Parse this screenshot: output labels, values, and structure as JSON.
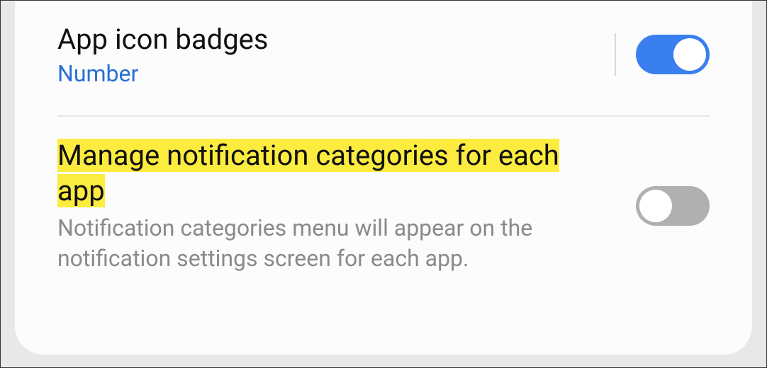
{
  "settings": {
    "badges": {
      "title": "App icon badges",
      "subtitle": "Number",
      "enabled": true
    },
    "categories": {
      "title": "Manage notification categories for each app",
      "description": "Notification categories menu will appear on the notification settings screen for each app.",
      "enabled": false
    }
  }
}
